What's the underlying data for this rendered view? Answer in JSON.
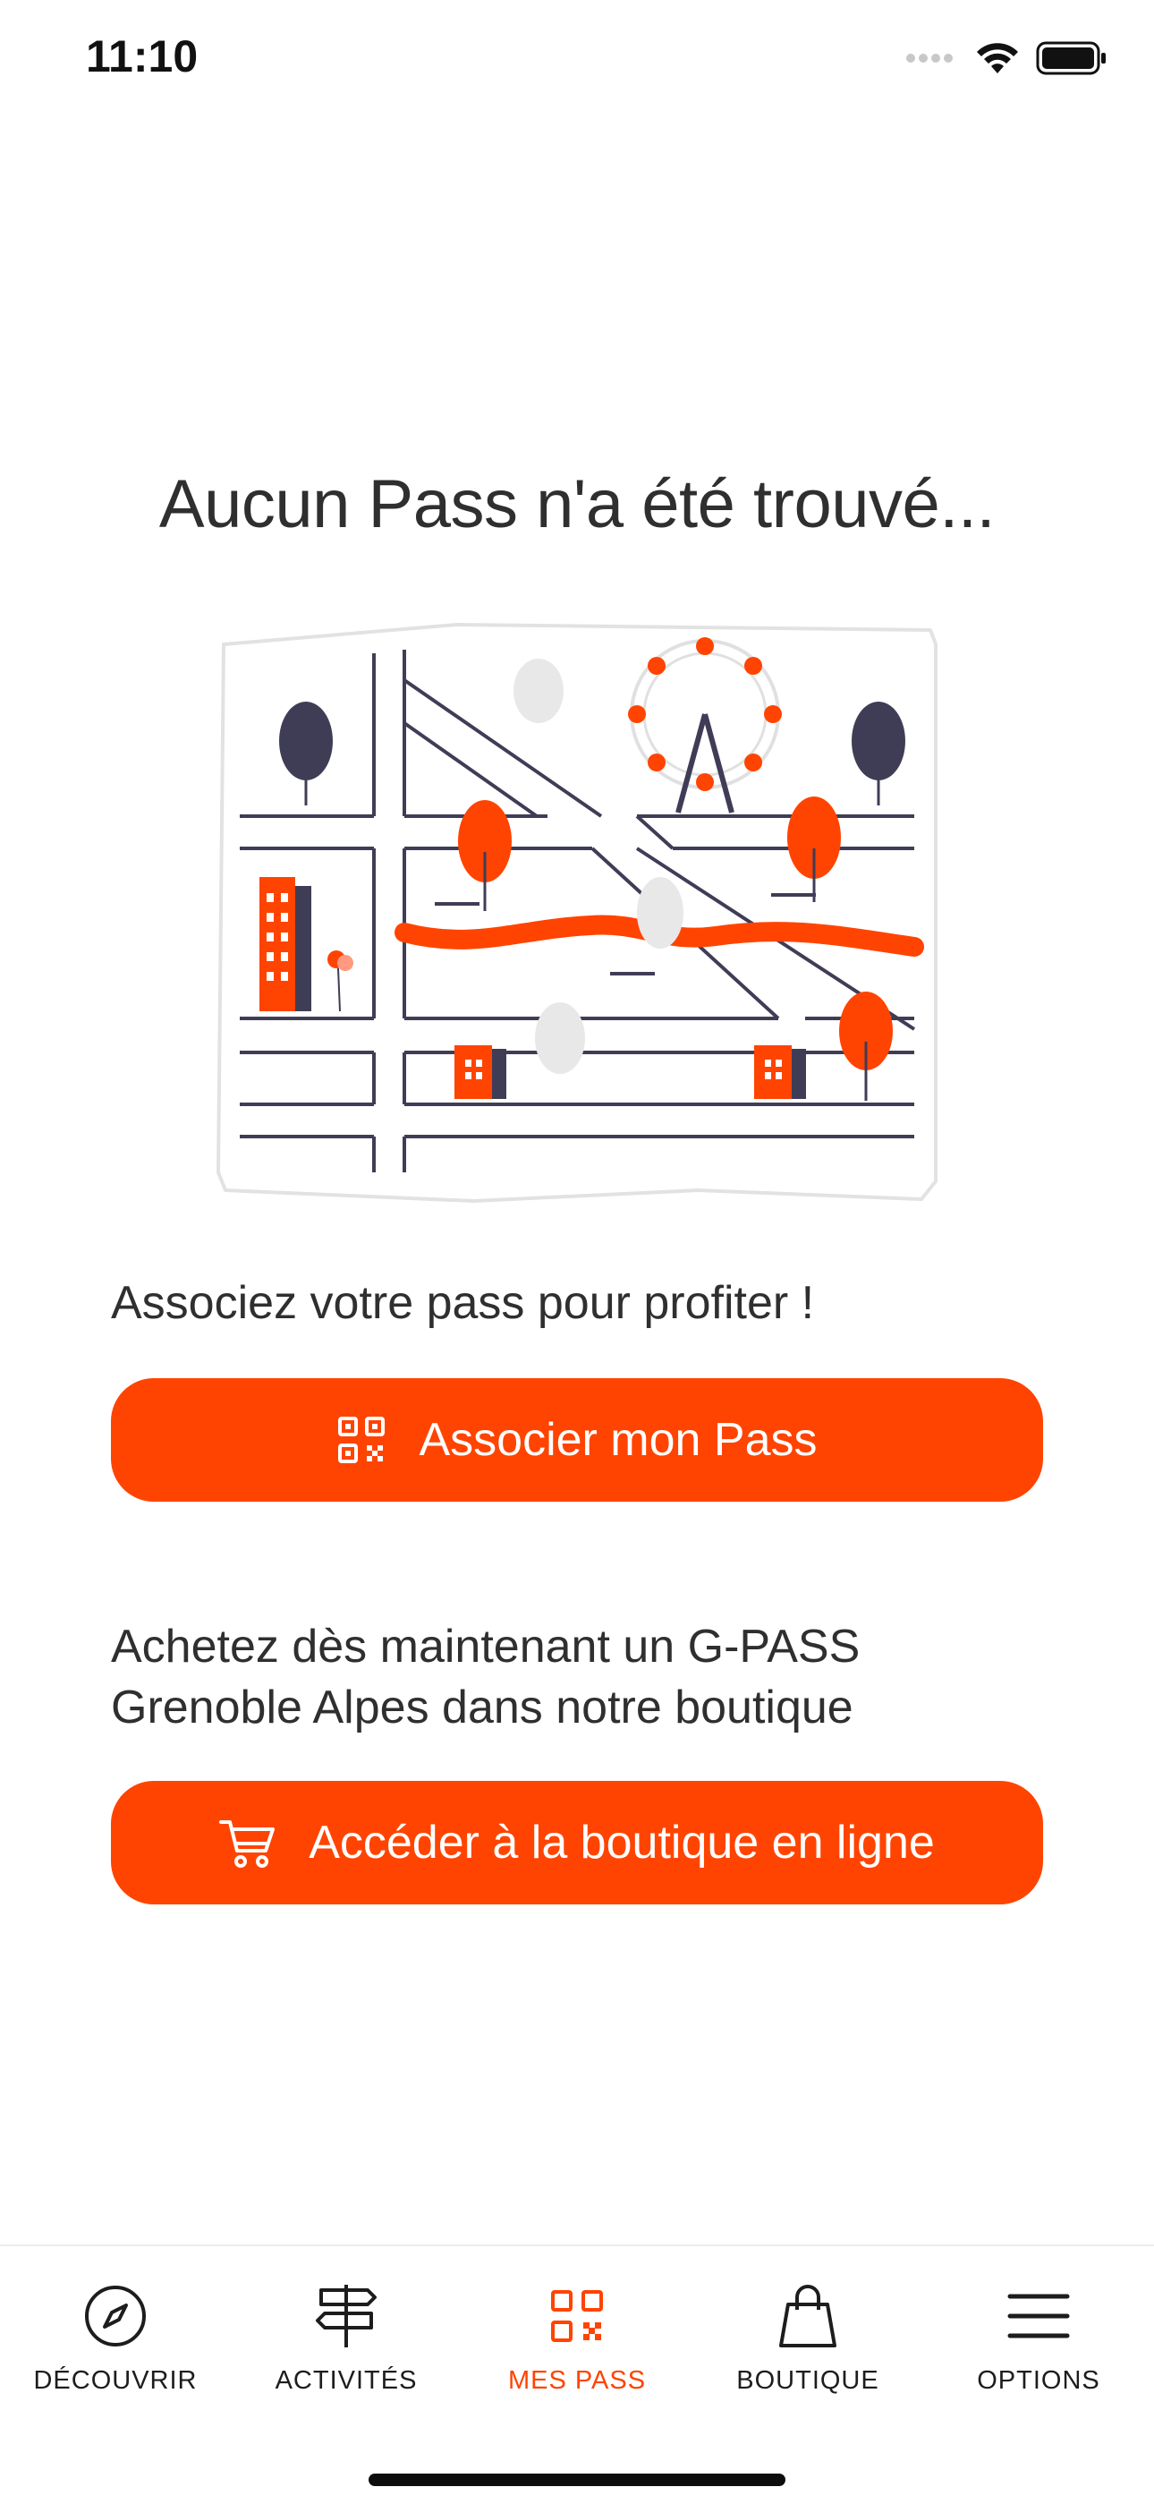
{
  "status_bar": {
    "time": "11:10"
  },
  "main": {
    "title": "Aucun Pass n'a été trouvé...",
    "illustration_icon": "city-map-illustration",
    "associate_prompt": "Associez votre pass pour profiter !",
    "associate_button_label": "Associer mon Pass",
    "associate_button_icon": "qr-code-icon",
    "shop_prompt": "Achetez dès maintenant un G-PASS Grenoble Alpes dans notre boutique",
    "shop_button_label": "Accéder à la boutique en ligne",
    "shop_button_icon": "cart-icon"
  },
  "tab_bar": {
    "items": [
      {
        "label": "DÉCOUVRIR",
        "icon": "compass-icon",
        "active": false
      },
      {
        "label": "ACTIVITÉS",
        "icon": "signpost-icon",
        "active": false
      },
      {
        "label": "MES PASS",
        "icon": "qr-code-icon",
        "active": true
      },
      {
        "label": "BOUTIQUE",
        "icon": "shopping-bag-icon",
        "active": false
      },
      {
        "label": "OPTIONS",
        "icon": "menu-icon",
        "active": false
      }
    ]
  },
  "colors": {
    "accent": "#ff4401",
    "text": "#2f2f2f",
    "dark_ink": "#3f3d56",
    "light_gray": "#e8e8e8"
  }
}
